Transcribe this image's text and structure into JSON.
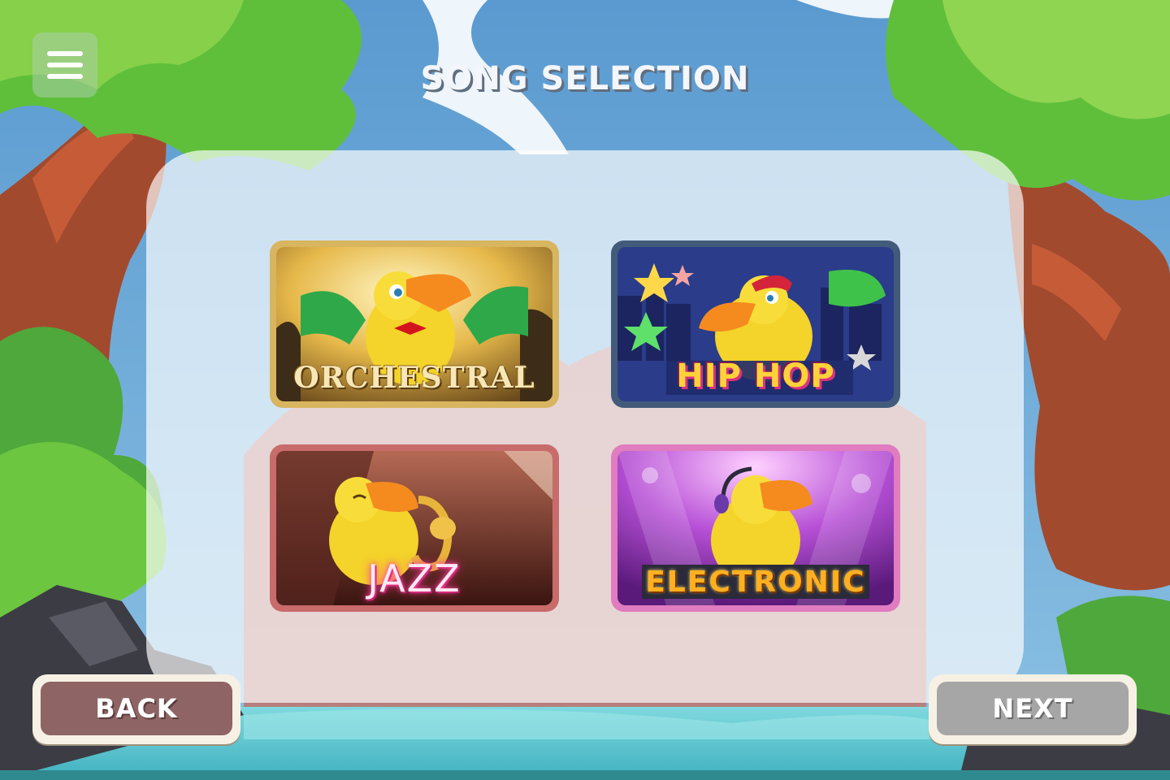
{
  "screen": {
    "title": "SONG SELECTION"
  },
  "menu": {
    "icon": "hamburger-menu-icon"
  },
  "genres": [
    {
      "id": "orchestral",
      "label": "ORCHESTRAL",
      "frame_color": "#d8b55f"
    },
    {
      "id": "hiphop",
      "label": "HIP HOP",
      "frame_color": "#435b7a"
    },
    {
      "id": "jazz",
      "label": "JAZZ",
      "frame_color": "#c86b6b"
    },
    {
      "id": "electronic",
      "label": "ELECTRONIC",
      "frame_color": "#e07cbf"
    }
  ],
  "buttons": {
    "back_label": "BACK",
    "next_label": "NEXT"
  },
  "colors": {
    "sky": "#5b9bd1",
    "foliage": "#5fbf3a",
    "water": "#57c7cf",
    "back_button": "#8e6464",
    "next_button_disabled": "#a6a6a6"
  }
}
